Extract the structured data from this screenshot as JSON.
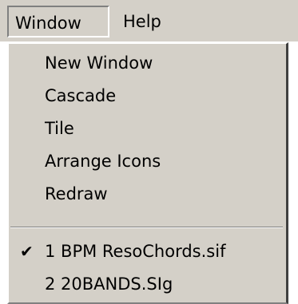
{
  "menubar": {
    "items": [
      {
        "label": "Window",
        "active": true
      },
      {
        "label": "Help",
        "active": false
      }
    ]
  },
  "window_menu": {
    "items": [
      {
        "label": "New Window"
      },
      {
        "label": "Cascade"
      },
      {
        "label": "Tile"
      },
      {
        "label": "Arrange Icons"
      },
      {
        "label": "Redraw"
      }
    ],
    "documents": [
      {
        "label": "1 BPM ResoChords.sif",
        "checked": true,
        "check_glyph": "✔"
      },
      {
        "label": "2 20BANDS.SIg",
        "checked": false
      }
    ]
  },
  "colors": {
    "menu_background": "#d4d0c8",
    "highlight": "#ffffff",
    "shadow": "#808080",
    "dark_shadow": "#404040",
    "text": "#000000"
  },
  "icons": {
    "check": "checkmark-icon"
  }
}
